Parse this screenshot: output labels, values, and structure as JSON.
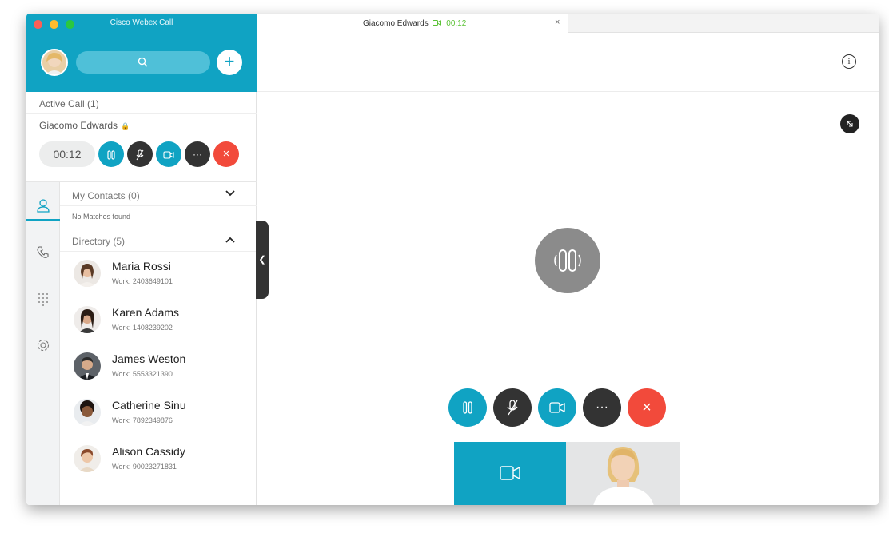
{
  "app": {
    "title": "Cisco Webex Call"
  },
  "colors": {
    "accent": "#10a3c3",
    "danger": "#f24a3b",
    "dark": "#333333",
    "traffic_red": "#fc5f57",
    "traffic_yellow": "#fdbc2e",
    "traffic_green": "#2ac840"
  },
  "icons": {
    "search": "search-icon",
    "add": "plus-icon",
    "lock": "lock-icon",
    "hold": "pause-icon",
    "mute": "mute-mic-icon",
    "video": "video-camera-icon",
    "more": "ellipsis-icon",
    "end": "close-icon",
    "contacts": "person-icon",
    "calls": "phone-icon",
    "dialpad": "dialpad-icon",
    "settings": "gear-icon",
    "info": "info-icon",
    "expand": "expand-icon"
  },
  "active_call": {
    "heading": "Active Call (1)",
    "caller": "Giacomo Edwards",
    "timer": "00:12"
  },
  "controls": {
    "more_label": "···",
    "end_label": "×"
  },
  "my_contacts": {
    "heading": "My Contacts (0)",
    "empty_text": "No Matches found"
  },
  "directory": {
    "heading": "Directory (5)",
    "contacts": [
      {
        "name": "Maria Rossi",
        "work": "Work: 2403649101"
      },
      {
        "name": "Karen Adams",
        "work": "Work: 1408239202"
      },
      {
        "name": "James Weston",
        "work": "Work: 5553321390"
      },
      {
        "name": "Catherine Sinu",
        "work": "Work: 7892349876"
      },
      {
        "name": "Alison Cassidy",
        "work": "Work: 90023271831"
      }
    ]
  },
  "tab": {
    "title": "Giacomo Edwards",
    "time": "00:12",
    "close": "×"
  },
  "info_glyph": "i"
}
